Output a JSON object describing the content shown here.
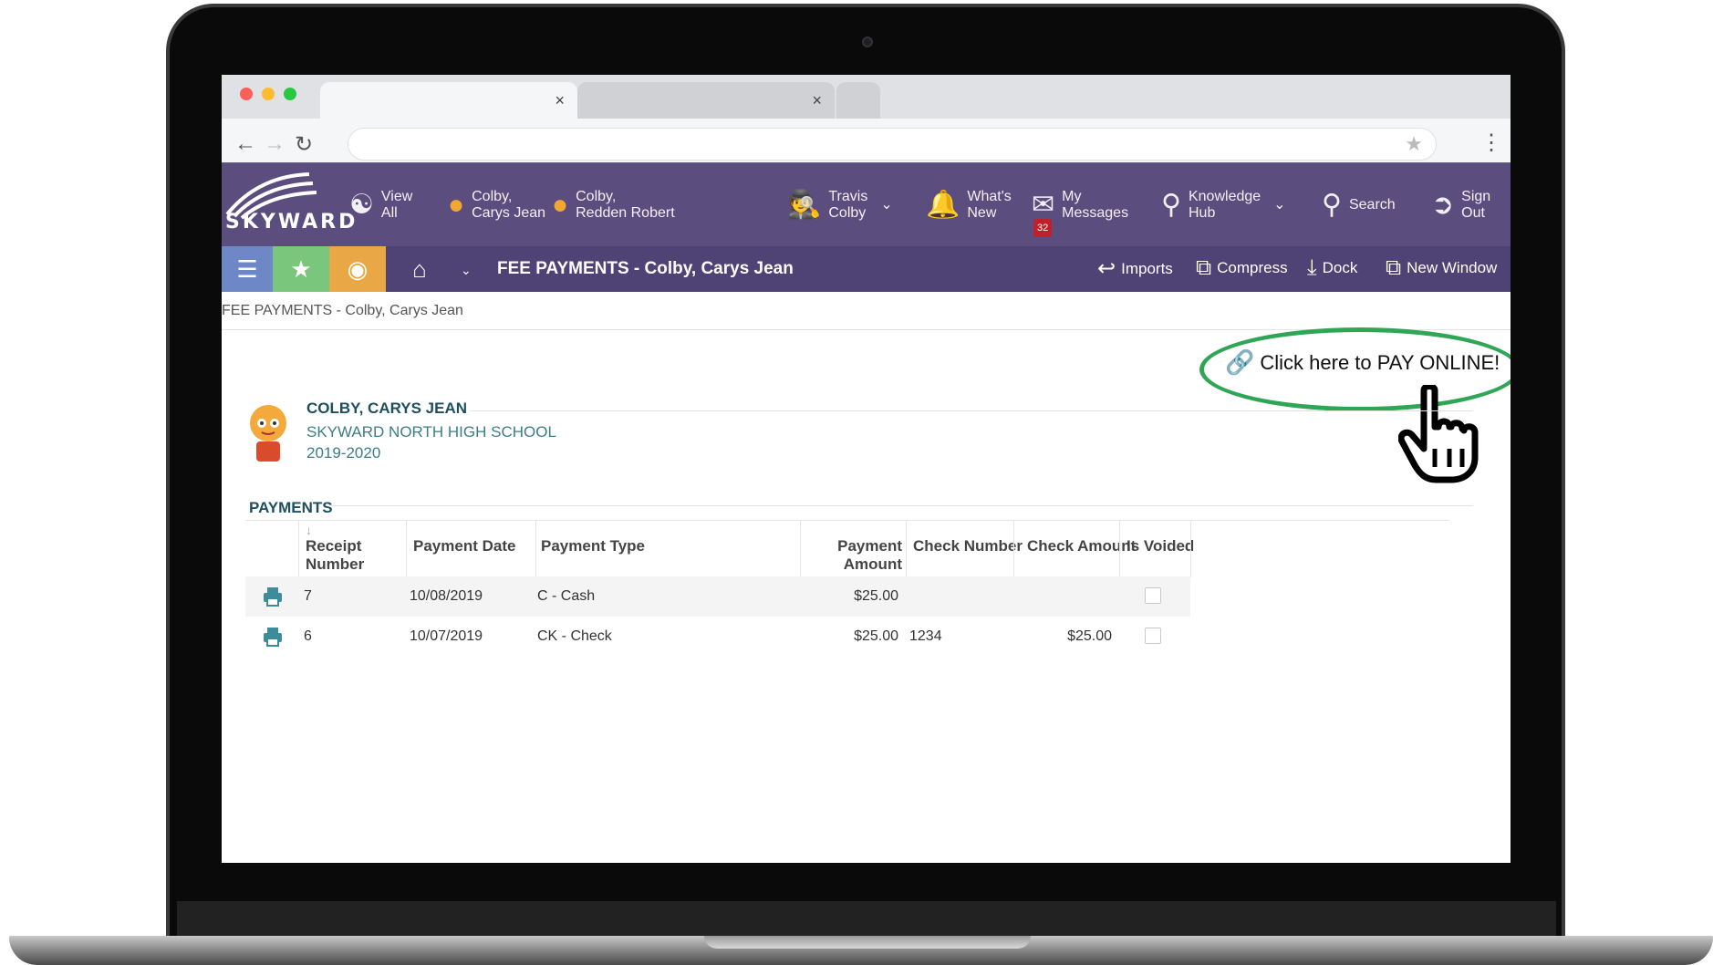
{
  "browser": {
    "tabs": [
      {
        "close": "×"
      },
      {
        "close": "×"
      }
    ]
  },
  "header": {
    "logo_text": "SKYWARD",
    "items": [
      {
        "line1": "View",
        "line2": "All"
      },
      {
        "line1": "Colby,",
        "line2": "Carys Jean"
      },
      {
        "line1": "Colby,",
        "line2": "Redden Robert"
      },
      {
        "line1": "Travis",
        "line2": "Colby"
      },
      {
        "line1": "What's",
        "line2": "New"
      },
      {
        "line1": "My",
        "line2": "Messages",
        "badge": "32"
      },
      {
        "line1": "Knowledge",
        "line2": "Hub"
      },
      {
        "line1": "Search"
      },
      {
        "line1": "Sign",
        "line2": "Out"
      }
    ]
  },
  "subbar": {
    "title": "FEE PAYMENTS - Colby, Carys Jean",
    "actions": [
      "Imports",
      "Compress",
      "Dock",
      "New Window"
    ]
  },
  "breadcrumb": "FEE PAYMENTS - Colby, Carys Jean",
  "pay_online": "Click here to PAY ONLINE!",
  "student": {
    "name": "COLBY, CARYS JEAN",
    "school": "SKYWARD NORTH HIGH SCHOOL",
    "year": "2019-2020"
  },
  "payments": {
    "label": "PAYMENTS",
    "columns": {
      "receipt_l1": "Receipt",
      "receipt_l2": "Number",
      "date": "Payment Date",
      "type": "Payment Type",
      "amount_l1": "Payment",
      "amount_l2": "Amount",
      "check_number": "Check Number",
      "check_amount": "Check Amount",
      "voided": "Is Voided"
    },
    "rows": [
      {
        "receipt": "7",
        "date": "10/08/2019",
        "type": "C - Cash",
        "amount": "$25.00",
        "check_number": "",
        "check_amount": ""
      },
      {
        "receipt": "6",
        "date": "10/07/2019",
        "type": "CK - Check",
        "amount": "$25.00",
        "check_number": "1234",
        "check_amount": "$25.00"
      }
    ]
  },
  "colors": {
    "header_purple": "#5b4d7e",
    "subbar_purple": "#4f4275",
    "teal_text": "#1e4f5e",
    "highlight_green": "#2fa655"
  }
}
